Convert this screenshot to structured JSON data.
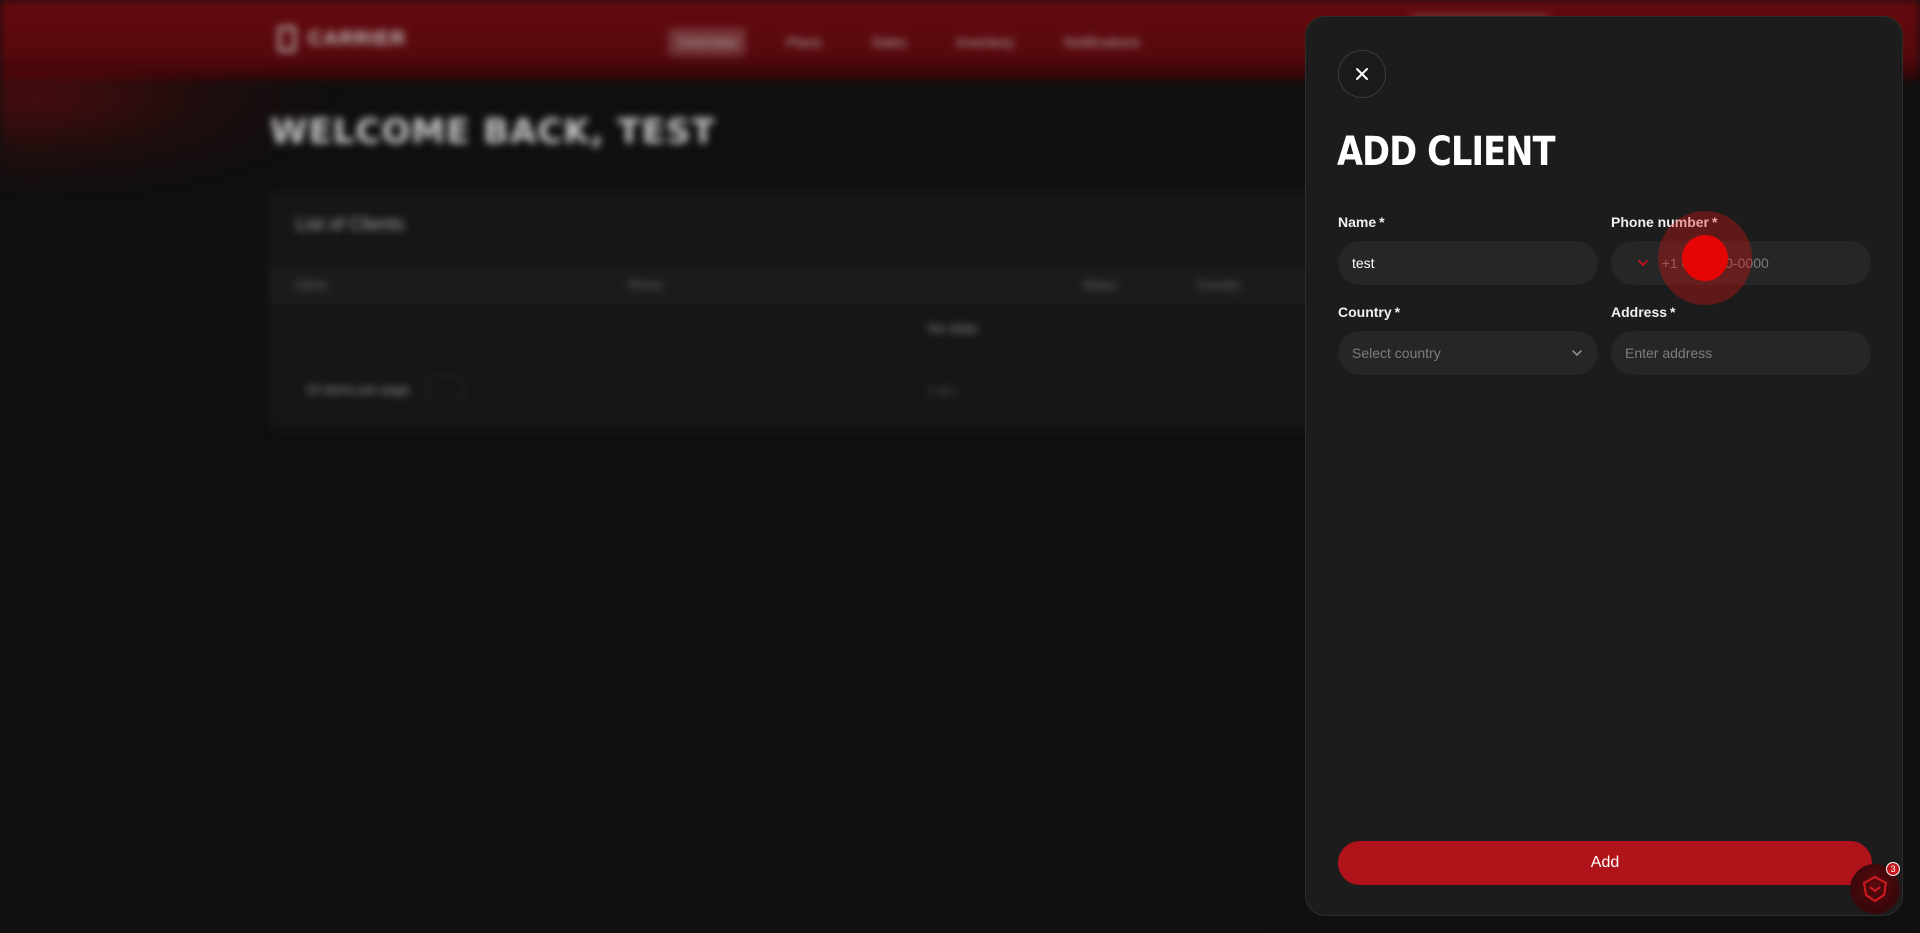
{
  "background": {
    "logo_text": "CARRIER",
    "nav": [
      "Overview",
      "Plans",
      "Sales",
      "Inventory",
      "Notifications"
    ],
    "welcome": "WELCOME BACK, TEST",
    "card_title": "List of Clients",
    "table_headers": [
      "Client",
      "Phone",
      "Status",
      "Country"
    ],
    "empty_text": "No data",
    "pager_label": "10 items per page",
    "page_count": "1 of 1"
  },
  "drawer": {
    "title": "ADD CLIENT",
    "name": {
      "label": "Name",
      "required": "*",
      "value": "test"
    },
    "phone": {
      "label": "Phone number",
      "required": "*",
      "placeholder": "+1 000-000-0000"
    },
    "country": {
      "label": "Country",
      "required": "*",
      "placeholder": "Select country"
    },
    "address": {
      "label": "Address",
      "required": "*",
      "placeholder": "Enter address"
    },
    "submit_label": "Add"
  },
  "widget": {
    "badge_count": "3"
  },
  "colors": {
    "accent": "#b01319",
    "panel": "#1c1c1c",
    "field": "#262626"
  }
}
